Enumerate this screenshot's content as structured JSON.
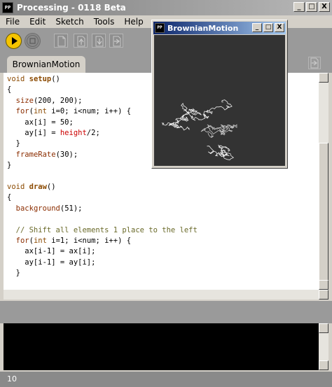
{
  "window": {
    "title": "Processing - 0118 Beta",
    "icon_text": "P",
    "buttons": [
      "_",
      "□",
      "X"
    ]
  },
  "menu": [
    "File",
    "Edit",
    "Sketch",
    "Tools",
    "Help"
  ],
  "toolbar": {
    "icons": [
      "run-icon",
      "stop-icon",
      "new-icon",
      "open-icon",
      "save-icon",
      "export-icon"
    ],
    "run_color": "#f5c400"
  },
  "tabs": [
    {
      "label": "BrownianMotion",
      "active": true
    }
  ],
  "editor": {
    "lines": [
      "void setup()",
      "{",
      "  size(200, 200);",
      "  for(int i=0; i<num; i++) {",
      "    ax[i] = 50;",
      "    ay[i] = height/2;",
      "  }",
      "  frameRate(30);",
      "}",
      "",
      "void draw()",
      "{",
      "  background(51);",
      "",
      "  // Shift all elements 1 place to the left",
      "  for(int i=1; i<num; i++) {",
      "    ax[i-1] = ax[i];",
      "    ay[i-1] = ay[i];",
      "  }"
    ]
  },
  "status": {
    "line_number": "10"
  },
  "sketch_window": {
    "title": "BrownianMotion",
    "buttons": [
      "_",
      "□",
      "X"
    ],
    "background": "#333333",
    "stroke": "#ffffff"
  }
}
